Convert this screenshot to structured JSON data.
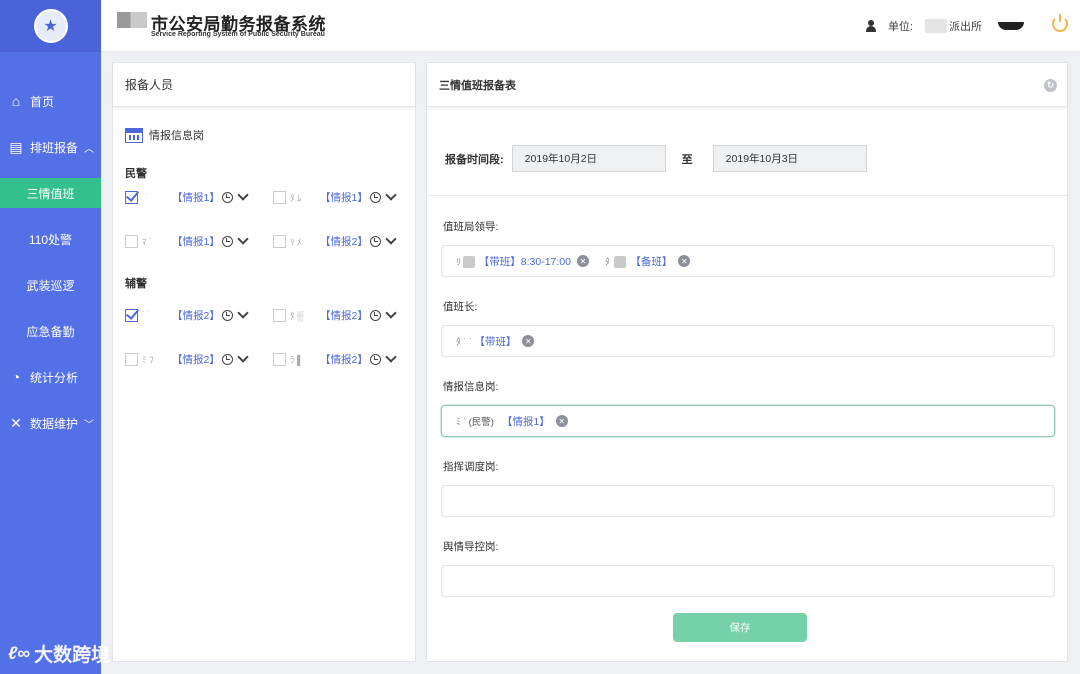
{
  "app": {
    "title": "市公安局勤务报备系统",
    "subtitle": "Service Reporting System of Public Security Bureau"
  },
  "header": {
    "unit_label": "单位:",
    "unit_value": "派出所"
  },
  "sidebar": {
    "items": [
      {
        "label": "首页",
        "icon": "home-icon"
      },
      {
        "label": "排班报备",
        "icon": "schedule-icon",
        "expanded": true
      },
      {
        "label": "统计分析",
        "icon": "pie-chart-icon"
      },
      {
        "label": "数据维护",
        "icon": "tools-icon"
      }
    ],
    "subitems": [
      {
        "label": "三情值班",
        "active": true
      },
      {
        "label": "110处警"
      },
      {
        "label": "武装巡逻"
      },
      {
        "label": "应急备勤"
      }
    ],
    "active_color": "#33c08d",
    "bg_color": "#5470e6"
  },
  "left_panel": {
    "title": "报备人员",
    "post": "情报信息岗",
    "groups": [
      {
        "label": "民警",
        "people": [
          {
            "tag": "【情报1】",
            "checked": true
          },
          {
            "tag": "【情报1】",
            "checked": false
          },
          {
            "tag": "【情报1】",
            "checked": false
          },
          {
            "tag": "【情报2】",
            "checked": false
          }
        ]
      },
      {
        "label": "辅警",
        "people": [
          {
            "tag": "【情报2】",
            "checked": true
          },
          {
            "tag": "【情报2】",
            "checked": false
          },
          {
            "tag": "【情报2】",
            "checked": false
          },
          {
            "tag": "【情报2】",
            "checked": false
          }
        ]
      }
    ]
  },
  "right_panel": {
    "title": "三情值班报备表",
    "period_label": "报备时间段:",
    "date_from": "2019年10月2日",
    "to_label": "至",
    "date_to": "2019年10月3日",
    "fields": [
      {
        "label": "值班局领导:",
        "chips": [
          {
            "tag": "【带班】8:30-17:00"
          },
          {
            "tag": "【备班】"
          }
        ]
      },
      {
        "label": "值班长:",
        "chips": [
          {
            "tag": "【带班】"
          }
        ]
      },
      {
        "label": "情报信息岗:",
        "chips": [
          {
            "name": "(民警)",
            "tag": "【情报1】"
          }
        ]
      },
      {
        "label": "指挥调度岗:",
        "chips": []
      },
      {
        "label": "舆情导控岗:",
        "chips": []
      }
    ],
    "save_label": "保存"
  },
  "watermark": "大数跨境"
}
